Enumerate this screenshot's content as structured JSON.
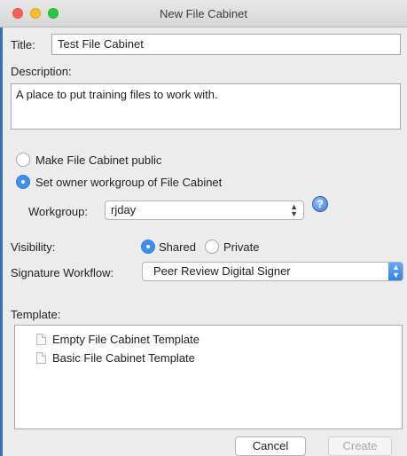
{
  "window": {
    "title": "New File Cabinet"
  },
  "title_field": {
    "label": "Title:",
    "value": "Test File Cabinet"
  },
  "description": {
    "label": "Description:",
    "value": "A place to put training files to work with."
  },
  "ownership": {
    "public_option": "Make File Cabinet public",
    "workgroup_option": "Set owner workgroup of File Cabinet",
    "selected": "workgroup"
  },
  "workgroup": {
    "label": "Workgroup:",
    "value": "rjday"
  },
  "visibility": {
    "label": "Visibility:",
    "shared": "Shared",
    "private": "Private",
    "selected": "shared"
  },
  "signature": {
    "label": "Signature Workflow:",
    "value": "Peer Review Digital Signer"
  },
  "template": {
    "label": "Template:",
    "items": [
      "Empty File Cabinet Template",
      "Basic File Cabinet Template"
    ]
  },
  "buttons": {
    "cancel": "Cancel",
    "create": "Create"
  },
  "colors": {
    "accent": "#3f8ff2",
    "window_edge": "#3b6fb3"
  },
  "icons": {
    "help": "help-icon",
    "doc": "document-icon",
    "stepper": "chevron-updown-icon"
  }
}
